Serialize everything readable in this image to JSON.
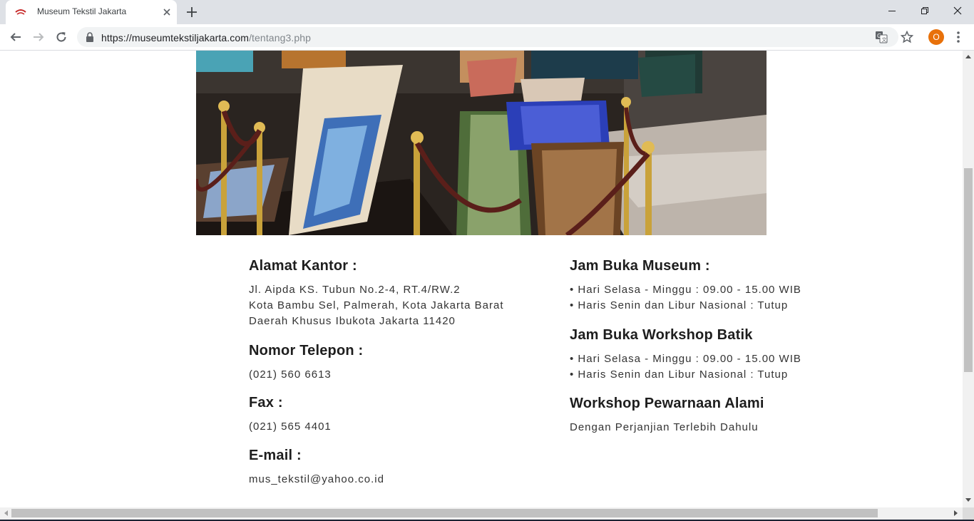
{
  "browser": {
    "tab_title": "Museum Tekstil Jakarta",
    "url_host": "https://museumtekstiljakarta.com",
    "url_path": "/tentang3.php",
    "profile_initial": "O",
    "accent_color": "#e8710a"
  },
  "hero_image": {
    "alt": "Batik textile exhibition hall"
  },
  "left_column": {
    "address_heading": "Alamat Kantor :",
    "address_lines": [
      "Jl. Aipda KS. Tubun No.2-4, RT.4/RW.2",
      "Kota Bambu Sel, Palmerah, Kota Jakarta Barat",
      "Daerah Khusus Ibukota Jakarta 11420"
    ],
    "phone_heading": "Nomor Telepon :",
    "phone_value": "(021) 560 6613",
    "fax_heading": "Fax :",
    "fax_value": "(021) 565 4401",
    "email_heading": "E-mail :",
    "email_value": "mus_tekstil@yahoo.co.id"
  },
  "right_column": {
    "museum_hours_heading": "Jam Buka Museum :",
    "museum_hours": [
      "• Hari Selasa - Minggu : 09.00 - 15.00 WIB",
      "• Haris Senin dan Libur Nasional : Tutup"
    ],
    "workshop_heading": "Jam Buka Workshop Batik",
    "workshop_hours": [
      "• Hari Selasa - Minggu : 09.00 - 15.00 WIB",
      "• Haris Senin dan Libur Nasional : Tutup"
    ],
    "dye_heading": "Workshop Pewarnaan Alami",
    "dye_text": "Dengan Perjanjian Terlebih Dahulu"
  }
}
